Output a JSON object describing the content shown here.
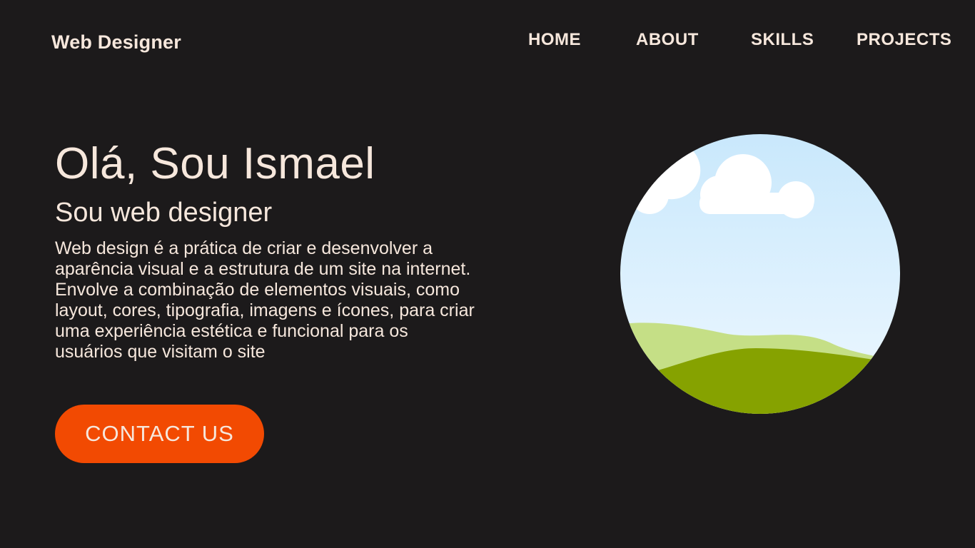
{
  "header": {
    "brand": "Web Designer",
    "nav": [
      "HOME",
      "ABOUT",
      "SKILLS",
      "PROJECTS"
    ]
  },
  "hero": {
    "title": "Olá, Sou Ismael",
    "subtitle": "Sou web designer",
    "description": "Web design é a prática de criar e desenvolver a aparência visual e a estrutura de um site na internet. Envolve a combinação de elementos visuais, como layout, cores, tipografia, imagens e ícones, para criar uma experiência estética e funcional para os usuários que visitam o site",
    "cta_label": "CONTACT US"
  },
  "illustration": {
    "icon": "landscape-icon",
    "sky_top_color": "#c9e8fc",
    "sky_bottom_color": "#eef8ff",
    "cloud_color": "#ffffff",
    "hill_back_color": "#c5df86",
    "hill_front_color": "#86a200"
  },
  "colors": {
    "background": "#1c1a1b",
    "text": "#f6e7dc",
    "accent": "#f24a02"
  }
}
